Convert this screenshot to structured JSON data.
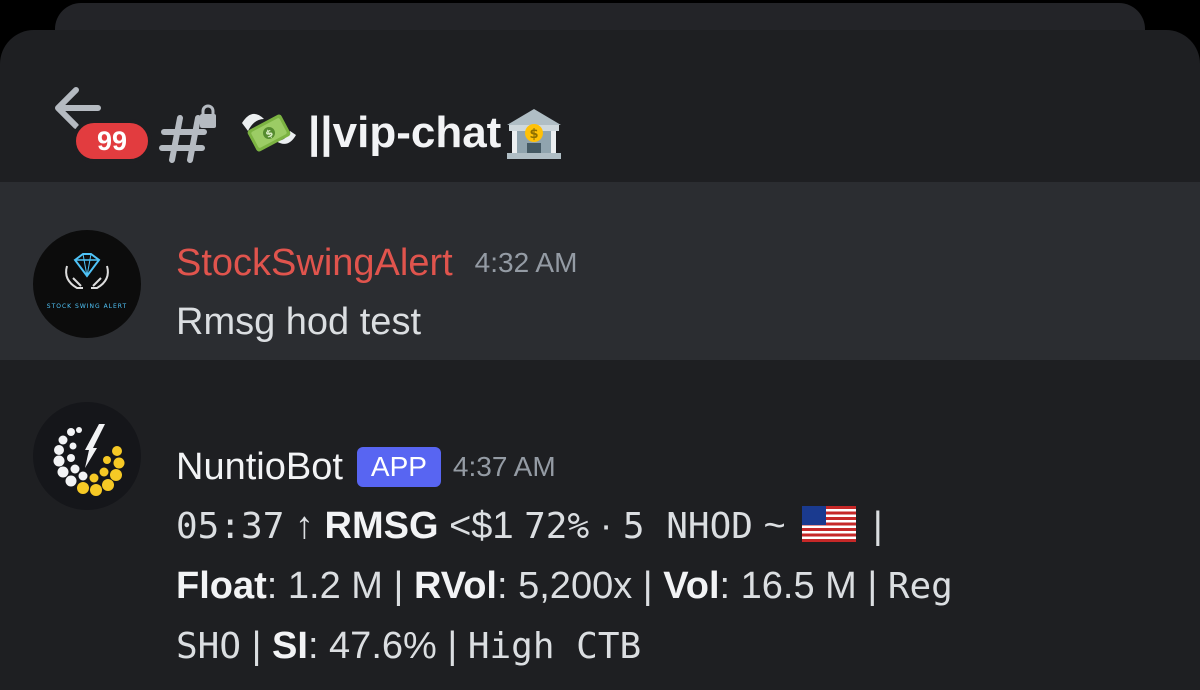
{
  "header": {
    "unread_count": "99",
    "channel_name": "||vip-chat"
  },
  "messages": [
    {
      "author": "StockSwingAlert",
      "author_color": "#e0544d",
      "timestamp": "4:32 AM",
      "avatar_text": "STOCK SWING ALERT",
      "text": "Rmsg hod test"
    },
    {
      "author": "NuntioBot",
      "tag": "APP",
      "timestamp": "4:37 AM",
      "alert": {
        "time": "05:37",
        "arrow": "↑",
        "ticker": "RMSG",
        "price_text": "<$1",
        "change": "72%",
        "dot": "·",
        "nhod": "5 NHOD",
        "tilde": "~",
        "pipe": "|",
        "float_label": "Float",
        "float_value": ": 1.2 M",
        "rvol_label": "RVol",
        "rvol_value": ": 5,200x",
        "vol_label": "Vol",
        "vol_value": ": 16.5 M",
        "reg_sho_1": "Reg",
        "reg_sho_2": "SHO",
        "si_label": "SI",
        "si_value": ": 47.6%",
        "ctb": "High CTB"
      }
    }
  ],
  "icons": {
    "back": "arrow-left-icon",
    "channel": "locked-hash-icon",
    "money": "money-with-wings-emoji",
    "bank": "bank-emoji",
    "flag": "us-flag-emoji"
  }
}
